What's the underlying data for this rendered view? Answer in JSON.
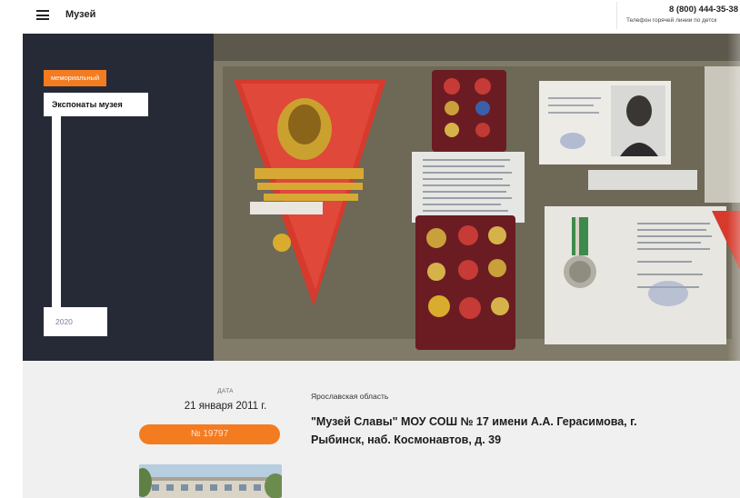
{
  "header": {
    "menu_icon": "hamburger-menu-icon",
    "title": "Музей",
    "phone": "8 (800) 444-35-38",
    "hotline": "Телефон горячей линии по детск"
  },
  "hero": {
    "tag": "мемориальный",
    "exhibit_label": "Экспонаты музея",
    "year": "2020",
    "colors": {
      "dark_panel": "#262a36",
      "accent": "#f47c20"
    }
  },
  "info": {
    "date_caption": "ДАТА",
    "date": "21 января 2011 г.",
    "number": "№ 19797",
    "region": "Ярославская область",
    "museum_title": "\"Музей Славы\" МОУ СОШ № 17 имени А.А. Герасимова, г. Рыбинск, наб. Космонавтов, д. 39"
  }
}
